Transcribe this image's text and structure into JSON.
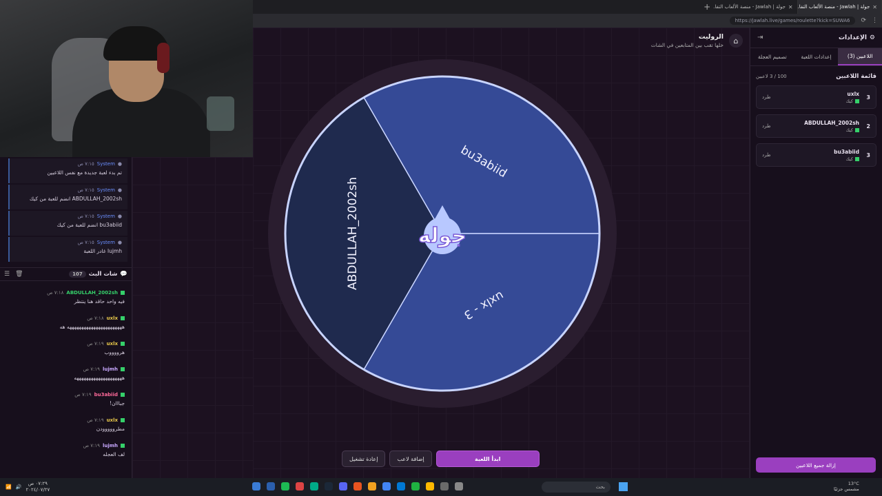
{
  "browser": {
    "tabs": [
      {
        "label": "جولة | Jawlah - منصة الألعاب التفا...",
        "active": false
      },
      {
        "label": "جولة | Jawlah - منصة الألعاب التفا...",
        "active": true
      }
    ],
    "url": "https://jawlah.live/games/roulette?kick=SUWA6"
  },
  "system_messages": [
    {
      "name": "System",
      "time": "٧:١٥ ص",
      "text": "تم بدء لعبة جديدة مع نفس اللاعبين"
    },
    {
      "name": "System",
      "time": "٧:١٥ ص",
      "text": "ABDULLAH_2002sh انضم للعبة من كيك"
    },
    {
      "name": "System",
      "time": "٧:١٥ ص",
      "text": "bu3abiid انضم للعبة من كيك"
    },
    {
      "name": "System",
      "time": "٧:١٥ ص",
      "text": "lujmh غادر اللعبة"
    }
  ],
  "chat": {
    "title": "شات البث",
    "count": "107",
    "messages": [
      {
        "name": "ABDULLAH_2002sh",
        "name_color": "#35d06a",
        "time": "٧:١٨ ص",
        "text": "فيه واحد حاقد هنا ينتظر"
      },
      {
        "name": "uxlx",
        "name_color": "#e8c84a",
        "time": "٧:١٨ ص",
        "text": "هههههههههههههههههههههههه هه"
      },
      {
        "name": "uxlx",
        "name_color": "#e8c84a",
        "time": "٧:١٩ ص",
        "text": "هرووووب"
      },
      {
        "name": "lujmh",
        "name_color": "#c8a8ff",
        "time": "٧:١٩ ص",
        "text": "ههههههههههههههههههههه"
      },
      {
        "name": "bu3abiid",
        "name_color": "#ff6a9a",
        "time": "٧:١٩ ص",
        "text": "جبااان!"
      },
      {
        "name": "uxlx",
        "name_color": "#e8c84a",
        "time": "٧:١٩ ص",
        "text": "مطرووووودن"
      },
      {
        "name": "lujmh",
        "name_color": "#c8a8ff",
        "time": "٧:١٩ ص",
        "text": "لف العجله"
      }
    ]
  },
  "page": {
    "title": "الروليت",
    "subtitle": "خلها تقب بين المتابعين في الشات"
  },
  "wheel": {
    "center_label": "جوله",
    "segments": [
      {
        "label": "bu3abiid",
        "color": "#354a96"
      },
      {
        "label": "uxlx - 3",
        "color": "#354a96"
      },
      {
        "label": "ABDULLAH_2002sh",
        "color": "#1f2a4e"
      }
    ]
  },
  "controls": {
    "start": "ابدأ اللعبة",
    "add_player": "إضافة لاعب",
    "restart": "إعادة تشغيل"
  },
  "settings": {
    "title": "الإعدادات",
    "tabs": [
      "اللاعبين (3)",
      "إعدادات اللعبة",
      "تصميم العجلة"
    ],
    "list_title": "قائمة اللاعبين",
    "list_count": "100 / 3 لاعبين",
    "players": [
      {
        "num": "3",
        "name": "uxlx",
        "platform": "كيك",
        "kick": "طرد"
      },
      {
        "num": "2",
        "name": "ABDULLAH_2002sh",
        "platform": "كيك",
        "kick": "طرد"
      },
      {
        "num": "3",
        "name": "bu3abiid",
        "platform": "كيك",
        "kick": "طرد"
      }
    ],
    "remove_all": "إزالة جميع اللاعبين"
  },
  "taskbar": {
    "time": "٠٧:٢٩ ص",
    "date": "٢٠٢٤/٠٧/٢٧",
    "search": "بحث",
    "weather_temp": "13°C",
    "weather_desc": "مشمس جزئيًا"
  },
  "colors": {
    "accent": "#9a3fbf",
    "wheel_light": "#354a96",
    "wheel_dark": "#1f2a4e",
    "wheel_border": "#c8d4ff"
  }
}
